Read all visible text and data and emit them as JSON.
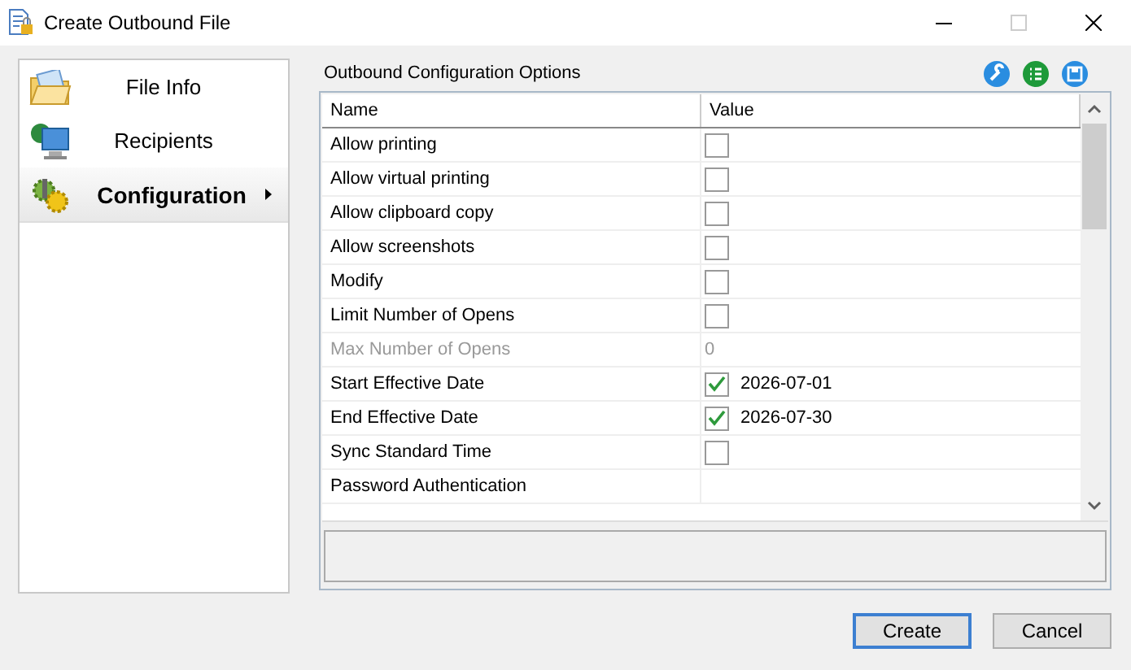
{
  "window": {
    "title": "Create Outbound File"
  },
  "sidebar": {
    "items": [
      {
        "label": "File Info",
        "kind": "folder",
        "selected": false
      },
      {
        "label": "Recipients",
        "kind": "computer",
        "selected": false
      },
      {
        "label": "Configuration",
        "kind": "gears",
        "selected": true
      }
    ]
  },
  "panel": {
    "title": "Outbound Configuration Options"
  },
  "grid": {
    "columns": [
      "Name",
      "Value"
    ],
    "rows": [
      {
        "name": "Allow printing",
        "kind": "checkbox",
        "checked": false,
        "disabled": false
      },
      {
        "name": "Allow virtual printing",
        "kind": "checkbox",
        "checked": false,
        "disabled": false
      },
      {
        "name": "Allow clipboard copy",
        "kind": "checkbox",
        "checked": false,
        "disabled": false
      },
      {
        "name": "Allow screenshots",
        "kind": "checkbox",
        "checked": false,
        "disabled": false
      },
      {
        "name": "Modify",
        "kind": "checkbox",
        "checked": false,
        "disabled": false
      },
      {
        "name": "Limit Number of Opens",
        "kind": "checkbox",
        "checked": false,
        "disabled": false
      },
      {
        "name": "Max Number of Opens",
        "kind": "text",
        "value": "0",
        "disabled": true
      },
      {
        "name": "Start Effective Date",
        "kind": "checkbox",
        "checked": true,
        "value": "2026-07-01",
        "disabled": false
      },
      {
        "name": "End Effective Date",
        "kind": "checkbox",
        "checked": true,
        "value": "2026-07-30",
        "disabled": false
      },
      {
        "name": "Sync Standard Time",
        "kind": "checkbox",
        "checked": false,
        "disabled": false
      },
      {
        "name": "Password Authentication",
        "kind": "blank",
        "disabled": false
      }
    ]
  },
  "buttons": [
    {
      "label": "Create",
      "default": true
    },
    {
      "label": "Cancel",
      "default": false
    }
  ]
}
